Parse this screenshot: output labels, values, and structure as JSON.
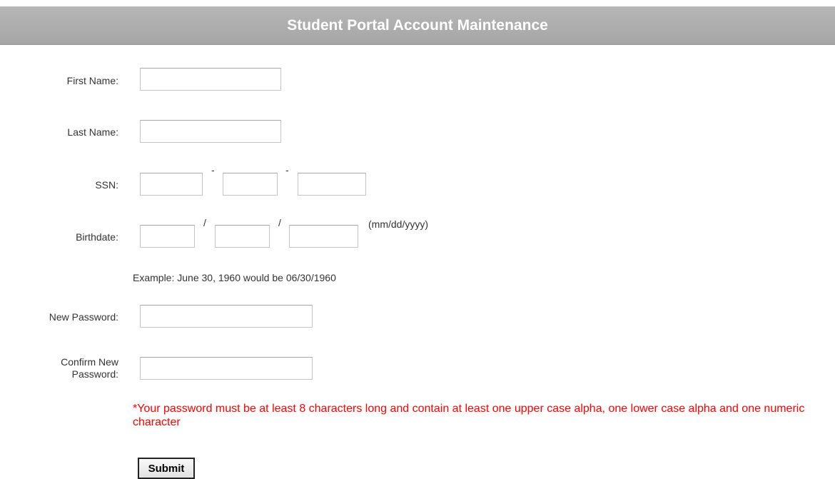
{
  "header": {
    "title": "Student Portal Account Maintenance"
  },
  "form": {
    "first_name": {
      "label": "First Name:",
      "value": ""
    },
    "last_name": {
      "label": "Last Name:",
      "value": ""
    },
    "ssn": {
      "label": "SSN:",
      "separator": "-",
      "part1": "",
      "part2": "",
      "part3": ""
    },
    "birthdate": {
      "label": "Birthdate:",
      "separator": "/",
      "format_hint": "(mm/dd/yyyy)",
      "month": "",
      "day": "",
      "year": "",
      "example": "Example: June 30, 1960 would be 06/30/1960"
    },
    "new_password": {
      "label": "New Password:",
      "value": ""
    },
    "confirm_password": {
      "label_line1": "Confirm New",
      "label_line2": "Password:",
      "value": ""
    },
    "password_rule": "*Your password must be at least 8 characters long and contain at least one upper case alpha, one lower case alpha and one numeric character",
    "submit_label": "Submit"
  }
}
